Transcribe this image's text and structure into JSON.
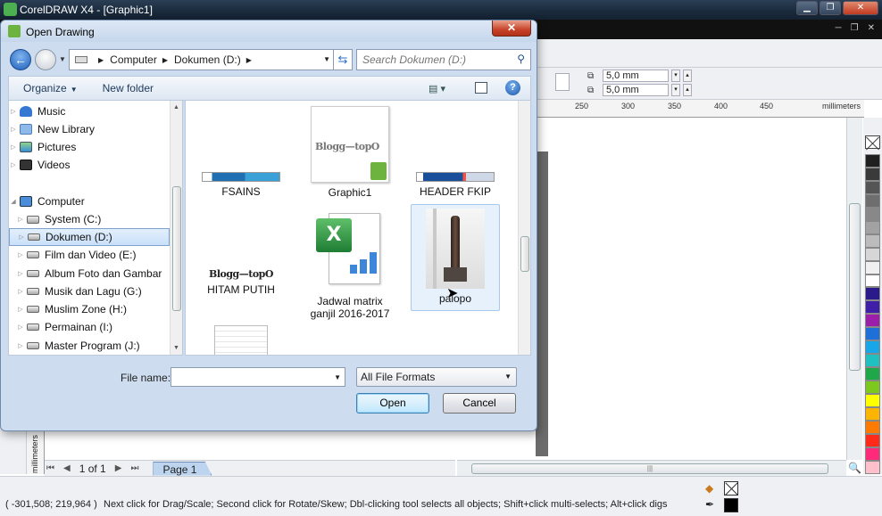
{
  "app": {
    "title": "CorelDRAW X4 - [Graphic1]",
    "window_buttons": {
      "minimize": "▁",
      "restore": "❐",
      "close": "✕"
    },
    "mdi_buttons": {
      "minimize": "─",
      "restore": "❐",
      "close": "✕"
    },
    "duplicate_x": "5,0 mm",
    "duplicate_y": "5,0 mm",
    "ruler_ticks": [
      "250",
      "300",
      "350",
      "400",
      "450"
    ],
    "ruler_unit": "millimeters",
    "ruler_unit_vertical": "millimeters",
    "palette_colors": [
      "#1f1f1f",
      "#3a3a3a",
      "#555555",
      "#6e6e6e",
      "#888888",
      "#a2a2a2",
      "#bcbcbc",
      "#d6d6d6",
      "#f0f0f0",
      "#ffffff",
      "#2b1a8a",
      "#3f1fa8",
      "#9b1fa8",
      "#1e6fd8",
      "#17a6e8",
      "#20c0c0",
      "#1ea84a",
      "#7cc81f",
      "#ffff00",
      "#ffb400",
      "#ff7a00",
      "#ff2a1a",
      "#ff2a7a",
      "#ffc0cb"
    ],
    "page_counter": "1 of 1",
    "page_tab": "Page 1",
    "coords": "( -301,508; 219,964 )",
    "status_hint": "Next click for Drag/Scale; Second click for Rotate/Skew; Dbl-clicking tool selects all objects; Shift+click multi-selects; Alt+click digs"
  },
  "dialog": {
    "title": "Open Drawing",
    "close": "✕",
    "breadcrumb": [
      "Computer",
      "Dokumen (D:)"
    ],
    "search_placeholder": "Search Dokumen (D:)",
    "organize": "Organize",
    "new_folder": "New folder",
    "help": "?",
    "nav": {
      "items": [
        {
          "label": "Music",
          "icon": "music-icon"
        },
        {
          "label": "New Library",
          "icon": "library-icon"
        },
        {
          "label": "Pictures",
          "icon": "pictures-icon"
        },
        {
          "label": "Videos",
          "icon": "videos-icon"
        },
        {
          "label": "Computer",
          "icon": "computer-icon"
        },
        {
          "label": "System (C:)",
          "icon": "drive-icon"
        },
        {
          "label": "Dokumen (D:)",
          "icon": "drive-icon",
          "selected": true
        },
        {
          "label": "Film dan Video (E:)",
          "icon": "drive-icon"
        },
        {
          "label": "Album Foto dan Gambar",
          "icon": "drive-icon"
        },
        {
          "label": "Musik dan Lagu (G:)",
          "icon": "drive-icon"
        },
        {
          "label": "Muslim Zone (H:)",
          "icon": "drive-icon"
        },
        {
          "label": "Permainan (I:)",
          "icon": "drive-icon"
        },
        {
          "label": "Master Program (J:)",
          "icon": "drive-icon"
        }
      ]
    },
    "files": [
      {
        "name": "FSAINS",
        "thumb": "banner-image"
      },
      {
        "name": "Graphic1",
        "thumb": "coreldraw-file-thumbnail",
        "thumb_text": "Blogg—topO"
      },
      {
        "name": "HEADER FKIP",
        "thumb": "banner-image"
      },
      {
        "name": "HITAM PUTIH",
        "thumb": "logo-image",
        "thumb_text": "Blogg—topO"
      },
      {
        "name": "Jadwal matrix ganjil 2016-2017",
        "thumb": "excel-file-icon",
        "thumb_text": "X"
      },
      {
        "name": "palopo",
        "thumb": "tower-photo",
        "selected": true
      }
    ],
    "file_name_label": "File name:",
    "file_name_value": "",
    "file_type": "All File Formats",
    "open_label": "Open",
    "cancel_label": "Cancel"
  }
}
